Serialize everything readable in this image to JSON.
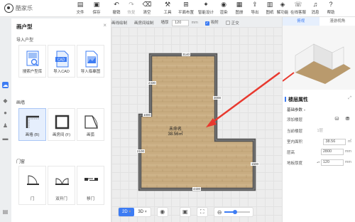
{
  "app": {
    "name": "酷家乐"
  },
  "toolbar": {
    "items": [
      {
        "label": "文件",
        "icon": "file-icon"
      },
      {
        "label": "保存",
        "icon": "save-icon"
      },
      {
        "label": "撤销",
        "icon": "undo-icon"
      },
      {
        "label": "恢复",
        "icon": "redo-icon"
      },
      {
        "label": "清空",
        "icon": "clear-icon"
      },
      {
        "label": "工具",
        "icon": "wrench-icon"
      },
      {
        "label": "平面布置",
        "icon": "layout-icon"
      },
      {
        "label": "智能设计",
        "icon": "ai-design-icon"
      },
      {
        "label": "渲染",
        "icon": "camera-icon"
      },
      {
        "label": "图册",
        "icon": "album-icon"
      },
      {
        "label": "导出",
        "icon": "export-icon"
      },
      {
        "label": "图纸",
        "icon": "drawing-icon"
      },
      {
        "label": "解功能",
        "icon": "function-icon"
      },
      {
        "label": "在线客服",
        "icon": "support-icon"
      },
      {
        "label": "消息",
        "icon": "bell-icon"
      },
      {
        "label": "帮助",
        "icon": "help-icon"
      }
    ]
  },
  "subbar": {
    "draw_wall": "画线绘制",
    "draw_room": "画房间绘制",
    "wall_thickness_label": "墙厚",
    "wall_thickness_value": "120",
    "wall_thickness_unit": "mm",
    "snap_label": "吸附",
    "ortho_label": "正交"
  },
  "left_panel": {
    "title": "画户型",
    "import_section": "导入户型",
    "import_cards": [
      "搜索户型库",
      "导入CAD",
      "导入临摹图"
    ],
    "wall_section": "画墙",
    "wall_cards": [
      "画墙 (B)",
      "画房间 (F)",
      "画弧"
    ],
    "door_section": "门窗",
    "door_cards": [
      "门",
      "双开门",
      "移门"
    ]
  },
  "floorplan": {
    "room_name": "未命名",
    "room_area": "38.56㎡",
    "dimensions": {
      "top": "3140",
      "left_upper": "2430",
      "left_lower": "2100",
      "middle_left": "1000",
      "right_upper": "3000",
      "right_lower": "1500",
      "bottom": "4430"
    }
  },
  "bottombar": {
    "view_2d": "2D",
    "view_3d": "3D",
    "zoom_level": 0.4
  },
  "right_panel": {
    "tabs": [
      "俯视",
      "漫游视角"
    ],
    "properties_title": "楼层属性",
    "basic_params": "基础参数",
    "rows": [
      {
        "label": "添加楼层",
        "value": ""
      },
      {
        "label": "当前楼层",
        "value": "1层"
      },
      {
        "label": "室内面积",
        "value": "38.56",
        "unit": "㎡"
      },
      {
        "label": "层高",
        "value": "2800",
        "unit": "mm"
      },
      {
        "label": "地板厚度",
        "value": "120",
        "unit": "mm"
      }
    ]
  },
  "colors": {
    "accent": "#3d7cf3",
    "floor": "#c9ad82",
    "wall": "#5a5a5a",
    "arrow": "#e8392f"
  }
}
